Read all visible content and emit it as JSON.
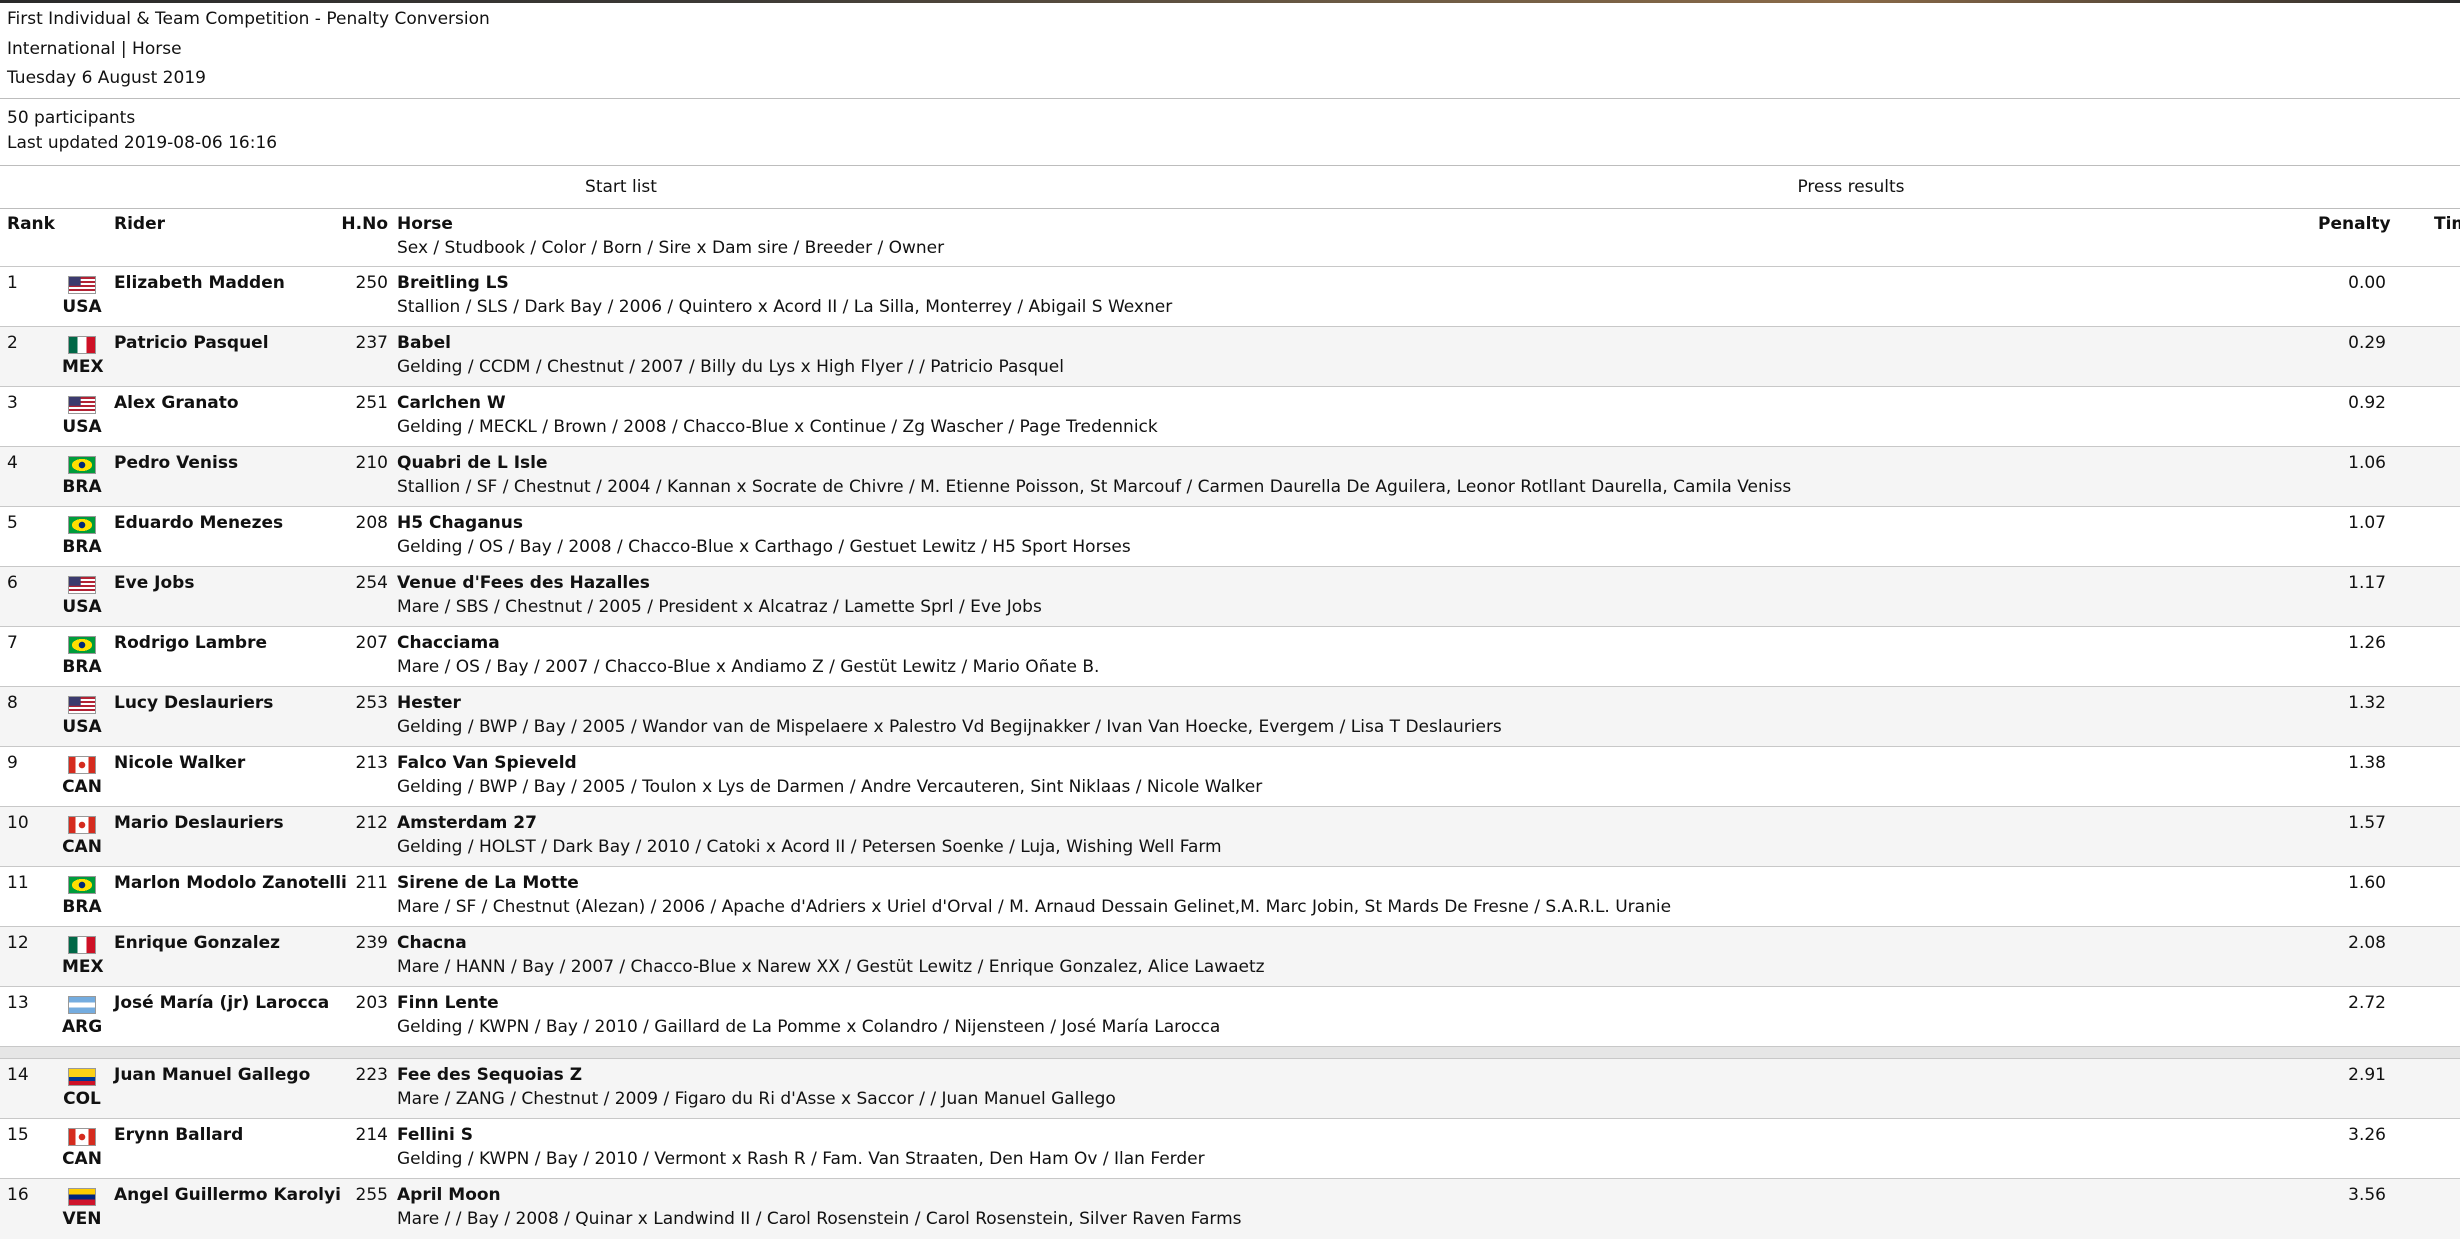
{
  "event": {
    "title": "First Individual & Team Competition - Penalty Conversion",
    "subtitle": "International | Horse",
    "date": "Tuesday 6 August 2019",
    "participants": "50 participants",
    "updated": "Last updated 2019-08-06 16:16"
  },
  "buttons": {
    "start_list": "Start list",
    "press_results": "Press results"
  },
  "columns": {
    "rank": "Rank",
    "rider": "Rider",
    "hno": "H.No",
    "horse": "Horse",
    "horse_sub": "Sex / Studbook / Color / Born / Sire x Dam sire / Breeder / Owner",
    "penalty": "Penalty",
    "time": "Tim"
  },
  "flag_colors": {
    "USA": [
      "#b22234",
      "#ffffff",
      "#3c3b6e"
    ],
    "MEX": [
      "#006847",
      "#ffffff",
      "#ce1126"
    ],
    "BRA": [
      "#009c3b",
      "#ffdf00",
      "#002776"
    ],
    "CAN": [
      "#d52b1e",
      "#ffffff",
      "#d52b1e"
    ],
    "ARG": [
      "#74acdf",
      "#ffffff",
      "#74acdf"
    ],
    "COL": [
      "#fcd116",
      "#003893",
      "#ce1126"
    ],
    "VEN": [
      "#ffcc00",
      "#00247d",
      "#cf142b"
    ]
  },
  "results": [
    {
      "rank": "1",
      "nation": "USA",
      "rider": "Elizabeth Madden",
      "hno": "250",
      "horse": "Breitling LS",
      "details": "Stallion / SLS / Dark Bay / 2006 / Quintero x Acord II / La Silla, Monterrey / Abigail S Wexner",
      "penalty": "0.00"
    },
    {
      "rank": "2",
      "nation": "MEX",
      "rider": "Patricio Pasquel",
      "hno": "237",
      "horse": "Babel",
      "details": "Gelding / CCDM / Chestnut / 2007 / Billy du Lys x High Flyer / / Patricio Pasquel",
      "penalty": "0.29"
    },
    {
      "rank": "3",
      "nation": "USA",
      "rider": "Alex Granato",
      "hno": "251",
      "horse": "Carlchen W",
      "details": "Gelding / MECKL / Brown / 2008 / Chacco-Blue x Continue / Zg Wascher / Page Tredennick",
      "penalty": "0.92"
    },
    {
      "rank": "4",
      "nation": "BRA",
      "rider": "Pedro Veniss",
      "hno": "210",
      "horse": "Quabri de L Isle",
      "details": "Stallion / SF / Chestnut / 2004 / Kannan x Socrate de Chivre / M. Etienne Poisson, St Marcouf / Carmen Daurella De Aguilera, Leonor Rotllant Daurella, Camila Veniss",
      "penalty": "1.06"
    },
    {
      "rank": "5",
      "nation": "BRA",
      "rider": "Eduardo Menezes",
      "hno": "208",
      "horse": "H5 Chaganus",
      "details": "Gelding / OS / Bay / 2008 / Chacco-Blue x Carthago / Gestuet Lewitz / H5 Sport Horses",
      "penalty": "1.07"
    },
    {
      "rank": "6",
      "nation": "USA",
      "rider": "Eve Jobs",
      "hno": "254",
      "horse": "Venue d'Fees des Hazalles",
      "details": "Mare / SBS / Chestnut / 2005 / President x Alcatraz / Lamette Sprl / Eve Jobs",
      "penalty": "1.17"
    },
    {
      "rank": "7",
      "nation": "BRA",
      "rider": "Rodrigo Lambre",
      "hno": "207",
      "horse": "Chacciama",
      "details": "Mare / OS / Bay / 2007 / Chacco-Blue x Andiamo Z / Gestüt Lewitz / Mario Oñate B.",
      "penalty": "1.26"
    },
    {
      "rank": "8",
      "nation": "USA",
      "rider": "Lucy Deslauriers",
      "hno": "253",
      "horse": "Hester",
      "details": "Gelding / BWP / Bay / 2005 / Wandor van de Mispelaere x Palestro Vd Begijnakker / Ivan Van Hoecke, Evergem / Lisa T Deslauriers",
      "penalty": "1.32"
    },
    {
      "rank": "9",
      "nation": "CAN",
      "rider": "Nicole Walker",
      "hno": "213",
      "horse": "Falco Van Spieveld",
      "details": "Gelding / BWP / Bay / 2005 / Toulon x Lys de Darmen / Andre Vercauteren, Sint Niklaas / Nicole Walker",
      "penalty": "1.38"
    },
    {
      "rank": "10",
      "nation": "CAN",
      "rider": "Mario Deslauriers",
      "hno": "212",
      "horse": "Amsterdam 27",
      "details": "Gelding / HOLST / Dark Bay / 2010 / Catoki x Acord II / Petersen Soenke / Luja, Wishing Well Farm",
      "penalty": "1.57"
    },
    {
      "rank": "11",
      "nation": "BRA",
      "rider": "Marlon Modolo Zanotelli",
      "hno": "211",
      "horse": "Sirene de La Motte",
      "details": "Mare / SF / Chestnut (Alezan) / 2006 / Apache d'Adriers x Uriel d'Orval / M. Arnaud Dessain Gelinet,M. Marc Jobin, St Mards De Fresne / S.A.R.L. Uranie",
      "penalty": "1.60"
    },
    {
      "rank": "12",
      "nation": "MEX",
      "rider": "Enrique Gonzalez",
      "hno": "239",
      "horse": "Chacna",
      "details": "Mare / HANN / Bay / 2007 / Chacco-Blue x Narew XX / Gestüt Lewitz / Enrique Gonzalez, Alice Lawaetz",
      "penalty": "2.08"
    },
    {
      "rank": "13",
      "nation": "ARG",
      "rider": "José María (jr) Larocca",
      "hno": "203",
      "horse": "Finn Lente",
      "details": "Gelding / KWPN / Bay / 2010 / Gaillard de La Pomme x Colandro / Nijensteen / José María Larocca",
      "penalty": "2.72"
    },
    {
      "rank": "14",
      "nation": "COL",
      "rider": "Juan Manuel Gallego",
      "hno": "223",
      "horse": "Fee des Sequoias Z",
      "details": "Mare / ZANG / Chestnut / 2009 / Figaro du Ri d'Asse x Saccor / / Juan Manuel Gallego",
      "penalty": "2.91"
    },
    {
      "rank": "15",
      "nation": "CAN",
      "rider": "Erynn Ballard",
      "hno": "214",
      "horse": "Fellini S",
      "details": "Gelding / KWPN / Bay / 2010 / Vermont x Rash R / Fam. Van Straaten, Den Ham Ov / Ilan Ferder",
      "penalty": "3.26"
    },
    {
      "rank": "16",
      "nation": "VEN",
      "rider": "Angel Guillermo Karolyi",
      "hno": "255",
      "horse": "April Moon",
      "details": "Mare / / Bay / 2008 / Quinar x Landwind II / Carol Rosenstein / Carol Rosenstein, Silver Raven Farms",
      "penalty": "3.56"
    }
  ]
}
